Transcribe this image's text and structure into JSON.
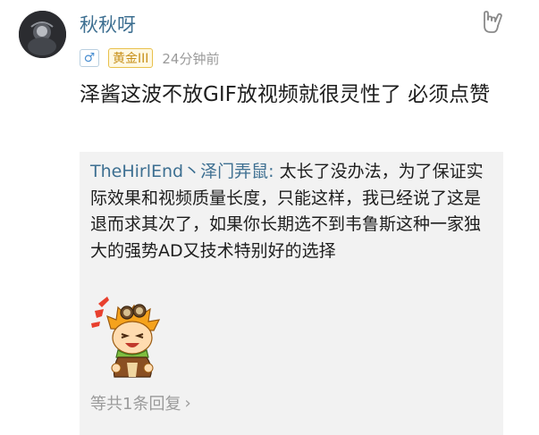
{
  "post": {
    "username": "秋秋呀",
    "gender_symbol": "♂",
    "rank": "黄金III",
    "time": "24分钟前",
    "comment": "泽酱这波不放GIF放视频就很灵性了 必须点赞"
  },
  "reply": {
    "author": "TheHirlEnd丶泽门弄鼠",
    "separator": ": ",
    "text": "太长了没办法，为了保证实际效果和视频质量长度，只能这样，我已经说了这是退而求其次了，如果你长期选不到韦鲁斯这种一家独大的强势AD又技术特别好的选择",
    "more_label": "等共1条回复",
    "more_chevron": "›"
  },
  "icons": {
    "avatar": "avatar-image",
    "gesture": "rock-hand-gesture-icon",
    "sticker": "laughing-cartoon-boy-sticker"
  },
  "colors": {
    "username": "#3d6f91",
    "rank_border": "#e8c04a",
    "rank_text": "#c7901a",
    "gender": "#4b8fd1",
    "reply_bg": "#f2f2f2"
  }
}
